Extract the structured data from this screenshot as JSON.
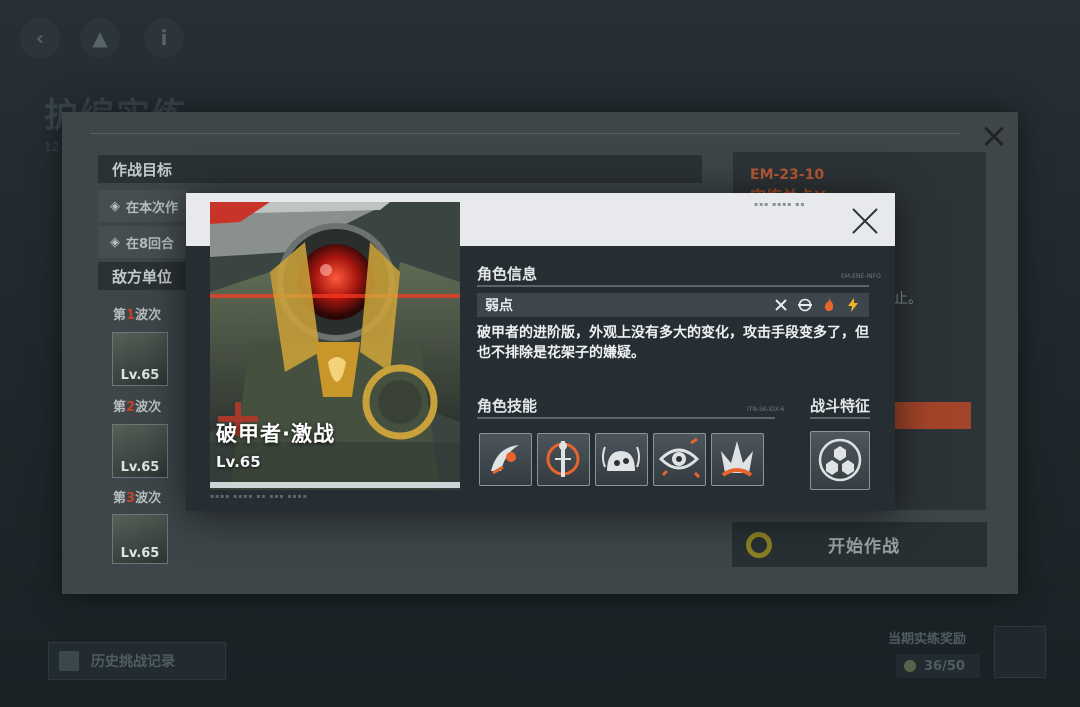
{
  "background": {
    "title": "护编实练",
    "subtitle": "12",
    "history_label": "历史挑战记录",
    "reward_label": "当期实练奖励",
    "reward_count": "36/50"
  },
  "stage": {
    "objectives_title": "作战目标",
    "objectives": [
      "在本次作",
      "在8回合"
    ],
    "enemies_title": "敌方单位",
    "waves": [
      {
        "prefix": "第",
        "num": "1",
        "suffix": "波次",
        "level": "Lv.65"
      },
      {
        "prefix": "第",
        "num": "2",
        "suffix": "波次",
        "level": "Lv.65"
      },
      {
        "prefix": "第",
        "num": "3",
        "suffix": "波次",
        "level": "Lv.65"
      }
    ],
    "code": "EM-23-10",
    "name": "实练关卡X",
    "desc_fragment": "止。",
    "start_label": "开始作战"
  },
  "dialog": {
    "char_name": "破甲者·激战",
    "char_level": "Lv.65",
    "info_title": "角色信息",
    "info_code": "EM-ENE-INFO",
    "weak_label": "弱点",
    "weak_icons": [
      "slash-icon",
      "pierce-icon",
      "fire-icon",
      "lightning-icon"
    ],
    "description": "破甲者的进阶版，外观上没有多大的变化，攻击手段变多了，但也不排除是花架子的嫌疑。",
    "skills_title": "角色技能",
    "skills_code": "ITN-SK-IDX-6",
    "trait_title": "战斗特征",
    "skills": [
      {
        "icon": "blade-slash-icon"
      },
      {
        "icon": "targeting-ring-icon"
      },
      {
        "icon": "dome-shield-icon"
      },
      {
        "icon": "scanning-eye-icon"
      },
      {
        "icon": "burst-flame-icon"
      }
    ],
    "trait_icon": "hexagon-cluster-icon",
    "colors": {
      "accent_orange": "#e8642c",
      "accent_yellow": "#f0b52a",
      "panel": "#262e33"
    }
  }
}
